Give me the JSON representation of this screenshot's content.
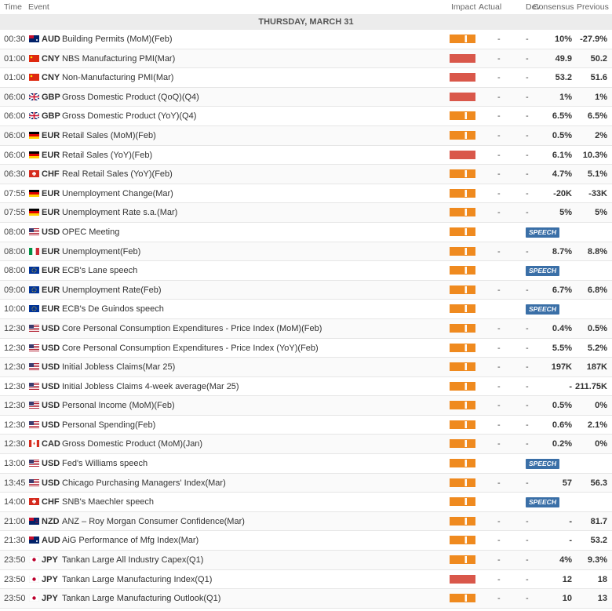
{
  "header": {
    "time": "Time",
    "event": "Event",
    "impact": "Impact",
    "actual": "Actual",
    "dev": "Dev",
    "consensus": "Consensus",
    "previous": "Previous"
  },
  "date_label": "THURSDAY, MARCH 31",
  "colors": {
    "impact_medium": "#ef8a1f",
    "impact_high": "#d9574a",
    "speech_badge": "#3a6fa7"
  },
  "rows": [
    {
      "time": "00:30",
      "flag": "australia-flag-icon",
      "cur": "AUD",
      "event": "Building Permits (MoM)(Feb)",
      "impact": "medium",
      "actual": "-",
      "dev": "-",
      "consensus": "10%",
      "previous": "-27.9%"
    },
    {
      "time": "01:00",
      "flag": "china-flag-icon",
      "cur": "CNY",
      "event": "NBS Manufacturing PMI(Mar)",
      "impact": "high",
      "actual": "-",
      "dev": "-",
      "consensus": "49.9",
      "previous": "50.2"
    },
    {
      "time": "01:00",
      "flag": "china-flag-icon",
      "cur": "CNY",
      "event": "Non-Manufacturing PMI(Mar)",
      "impact": "high",
      "actual": "-",
      "dev": "-",
      "consensus": "53.2",
      "previous": "51.6"
    },
    {
      "time": "06:00",
      "flag": "uk-flag-icon",
      "cur": "GBP",
      "event": "Gross Domestic Product (QoQ)(Q4)",
      "impact": "high",
      "actual": "-",
      "dev": "-",
      "consensus": "1%",
      "previous": "1%"
    },
    {
      "time": "06:00",
      "flag": "uk-flag-icon",
      "cur": "GBP",
      "event": "Gross Domestic Product (YoY)(Q4)",
      "impact": "medium",
      "actual": "-",
      "dev": "-",
      "consensus": "6.5%",
      "previous": "6.5%"
    },
    {
      "time": "06:00",
      "flag": "germany-flag-icon",
      "cur": "EUR",
      "event": "Retail Sales (MoM)(Feb)",
      "impact": "medium",
      "actual": "-",
      "dev": "-",
      "consensus": "0.5%",
      "previous": "2%"
    },
    {
      "time": "06:00",
      "flag": "germany-flag-icon",
      "cur": "EUR",
      "event": "Retail Sales (YoY)(Feb)",
      "impact": "high",
      "actual": "-",
      "dev": "-",
      "consensus": "6.1%",
      "previous": "10.3%"
    },
    {
      "time": "06:30",
      "flag": "switzerland-flag-icon",
      "cur": "CHF",
      "event": "Real Retail Sales (YoY)(Feb)",
      "impact": "medium",
      "actual": "-",
      "dev": "-",
      "consensus": "4.7%",
      "previous": "5.1%"
    },
    {
      "time": "07:55",
      "flag": "germany-flag-icon",
      "cur": "EUR",
      "event": "Unemployment Change(Mar)",
      "impact": "medium",
      "actual": "-",
      "dev": "-",
      "consensus": "-20K",
      "previous": "-33K"
    },
    {
      "time": "07:55",
      "flag": "germany-flag-icon",
      "cur": "EUR",
      "event": "Unemployment Rate s.a.(Mar)",
      "impact": "medium",
      "actual": "-",
      "dev": "-",
      "consensus": "5%",
      "previous": "5%"
    },
    {
      "time": "08:00",
      "flag": "usa-flag-icon",
      "cur": "USD",
      "event": "OPEC Meeting",
      "impact": "medium",
      "speech": "SPEECH"
    },
    {
      "time": "08:00",
      "flag": "italy-flag-icon",
      "cur": "EUR",
      "event": "Unemployment(Feb)",
      "impact": "medium",
      "actual": "-",
      "dev": "-",
      "consensus": "8.7%",
      "previous": "8.8%"
    },
    {
      "time": "08:00",
      "flag": "eu-flag-icon",
      "cur": "EUR",
      "event": "ECB's Lane speech",
      "impact": "medium",
      "speech": "SPEECH"
    },
    {
      "time": "09:00",
      "flag": "eu-flag-icon",
      "cur": "EUR",
      "event": "Unemployment Rate(Feb)",
      "impact": "medium",
      "actual": "-",
      "dev": "-",
      "consensus": "6.7%",
      "previous": "6.8%"
    },
    {
      "time": "10:00",
      "flag": "eu-flag-icon",
      "cur": "EUR",
      "event": "ECB's De Guindos speech",
      "impact": "medium",
      "speech": "SPEECH"
    },
    {
      "time": "12:30",
      "flag": "usa-flag-icon",
      "cur": "USD",
      "event": "Core Personal Consumption Expenditures - Price Index (MoM)(Feb)",
      "impact": "medium",
      "actual": "-",
      "dev": "-",
      "consensus": "0.4%",
      "previous": "0.5%"
    },
    {
      "time": "12:30",
      "flag": "usa-flag-icon",
      "cur": "USD",
      "event": "Core Personal Consumption Expenditures - Price Index (YoY)(Feb)",
      "impact": "medium",
      "actual": "-",
      "dev": "-",
      "consensus": "5.5%",
      "previous": "5.2%"
    },
    {
      "time": "12:30",
      "flag": "usa-flag-icon",
      "cur": "USD",
      "event": "Initial Jobless Claims(Mar 25)",
      "impact": "medium",
      "actual": "-",
      "dev": "-",
      "consensus": "197K",
      "previous": "187K"
    },
    {
      "time": "12:30",
      "flag": "usa-flag-icon",
      "cur": "USD",
      "event": "Initial Jobless Claims 4-week average(Mar 25)",
      "impact": "medium",
      "actual": "-",
      "dev": "-",
      "consensus": "-",
      "previous": "211.75K"
    },
    {
      "time": "12:30",
      "flag": "usa-flag-icon",
      "cur": "USD",
      "event": "Personal Income (MoM)(Feb)",
      "impact": "medium",
      "actual": "-",
      "dev": "-",
      "consensus": "0.5%",
      "previous": "0%"
    },
    {
      "time": "12:30",
      "flag": "usa-flag-icon",
      "cur": "USD",
      "event": "Personal Spending(Feb)",
      "impact": "medium",
      "actual": "-",
      "dev": "-",
      "consensus": "0.6%",
      "previous": "2.1%"
    },
    {
      "time": "12:30",
      "flag": "canada-flag-icon",
      "cur": "CAD",
      "event": "Gross Domestic Product (MoM)(Jan)",
      "impact": "medium",
      "actual": "-",
      "dev": "-",
      "consensus": "0.2%",
      "previous": "0%"
    },
    {
      "time": "13:00",
      "flag": "usa-flag-icon",
      "cur": "USD",
      "event": "Fed's Williams speech",
      "impact": "medium",
      "speech": "SPEECH"
    },
    {
      "time": "13:45",
      "flag": "usa-flag-icon",
      "cur": "USD",
      "event": "Chicago Purchasing Managers' Index(Mar)",
      "impact": "medium",
      "actual": "-",
      "dev": "-",
      "consensus": "57",
      "previous": "56.3"
    },
    {
      "time": "14:00",
      "flag": "switzerland-flag-icon",
      "cur": "CHF",
      "event": "SNB's Maechler speech",
      "impact": "medium",
      "speech": "SPEECH"
    },
    {
      "time": "21:00",
      "flag": "newzealand-flag-icon",
      "cur": "NZD",
      "event": "ANZ – Roy Morgan Consumer Confidence(Mar)",
      "impact": "medium",
      "actual": "-",
      "dev": "-",
      "consensus": "-",
      "previous": "81.7"
    },
    {
      "time": "21:30",
      "flag": "australia-flag-icon",
      "cur": "AUD",
      "event": "AiG Performance of Mfg Index(Mar)",
      "impact": "medium",
      "actual": "-",
      "dev": "-",
      "consensus": "-",
      "previous": "53.2"
    },
    {
      "time": "23:50",
      "flag": "japan-flag-icon",
      "cur": "JPY",
      "event": "Tankan Large All Industry Capex(Q1)",
      "impact": "medium",
      "actual": "-",
      "dev": "-",
      "consensus": "4%",
      "previous": "9.3%"
    },
    {
      "time": "23:50",
      "flag": "japan-flag-icon",
      "cur": "JPY",
      "event": "Tankan Large Manufacturing Index(Q1)",
      "impact": "high",
      "actual": "-",
      "dev": "-",
      "consensus": "12",
      "previous": "18"
    },
    {
      "time": "23:50",
      "flag": "japan-flag-icon",
      "cur": "JPY",
      "event": "Tankan Large Manufacturing Outlook(Q1)",
      "impact": "medium",
      "actual": "-",
      "dev": "-",
      "consensus": "10",
      "previous": "13"
    }
  ]
}
